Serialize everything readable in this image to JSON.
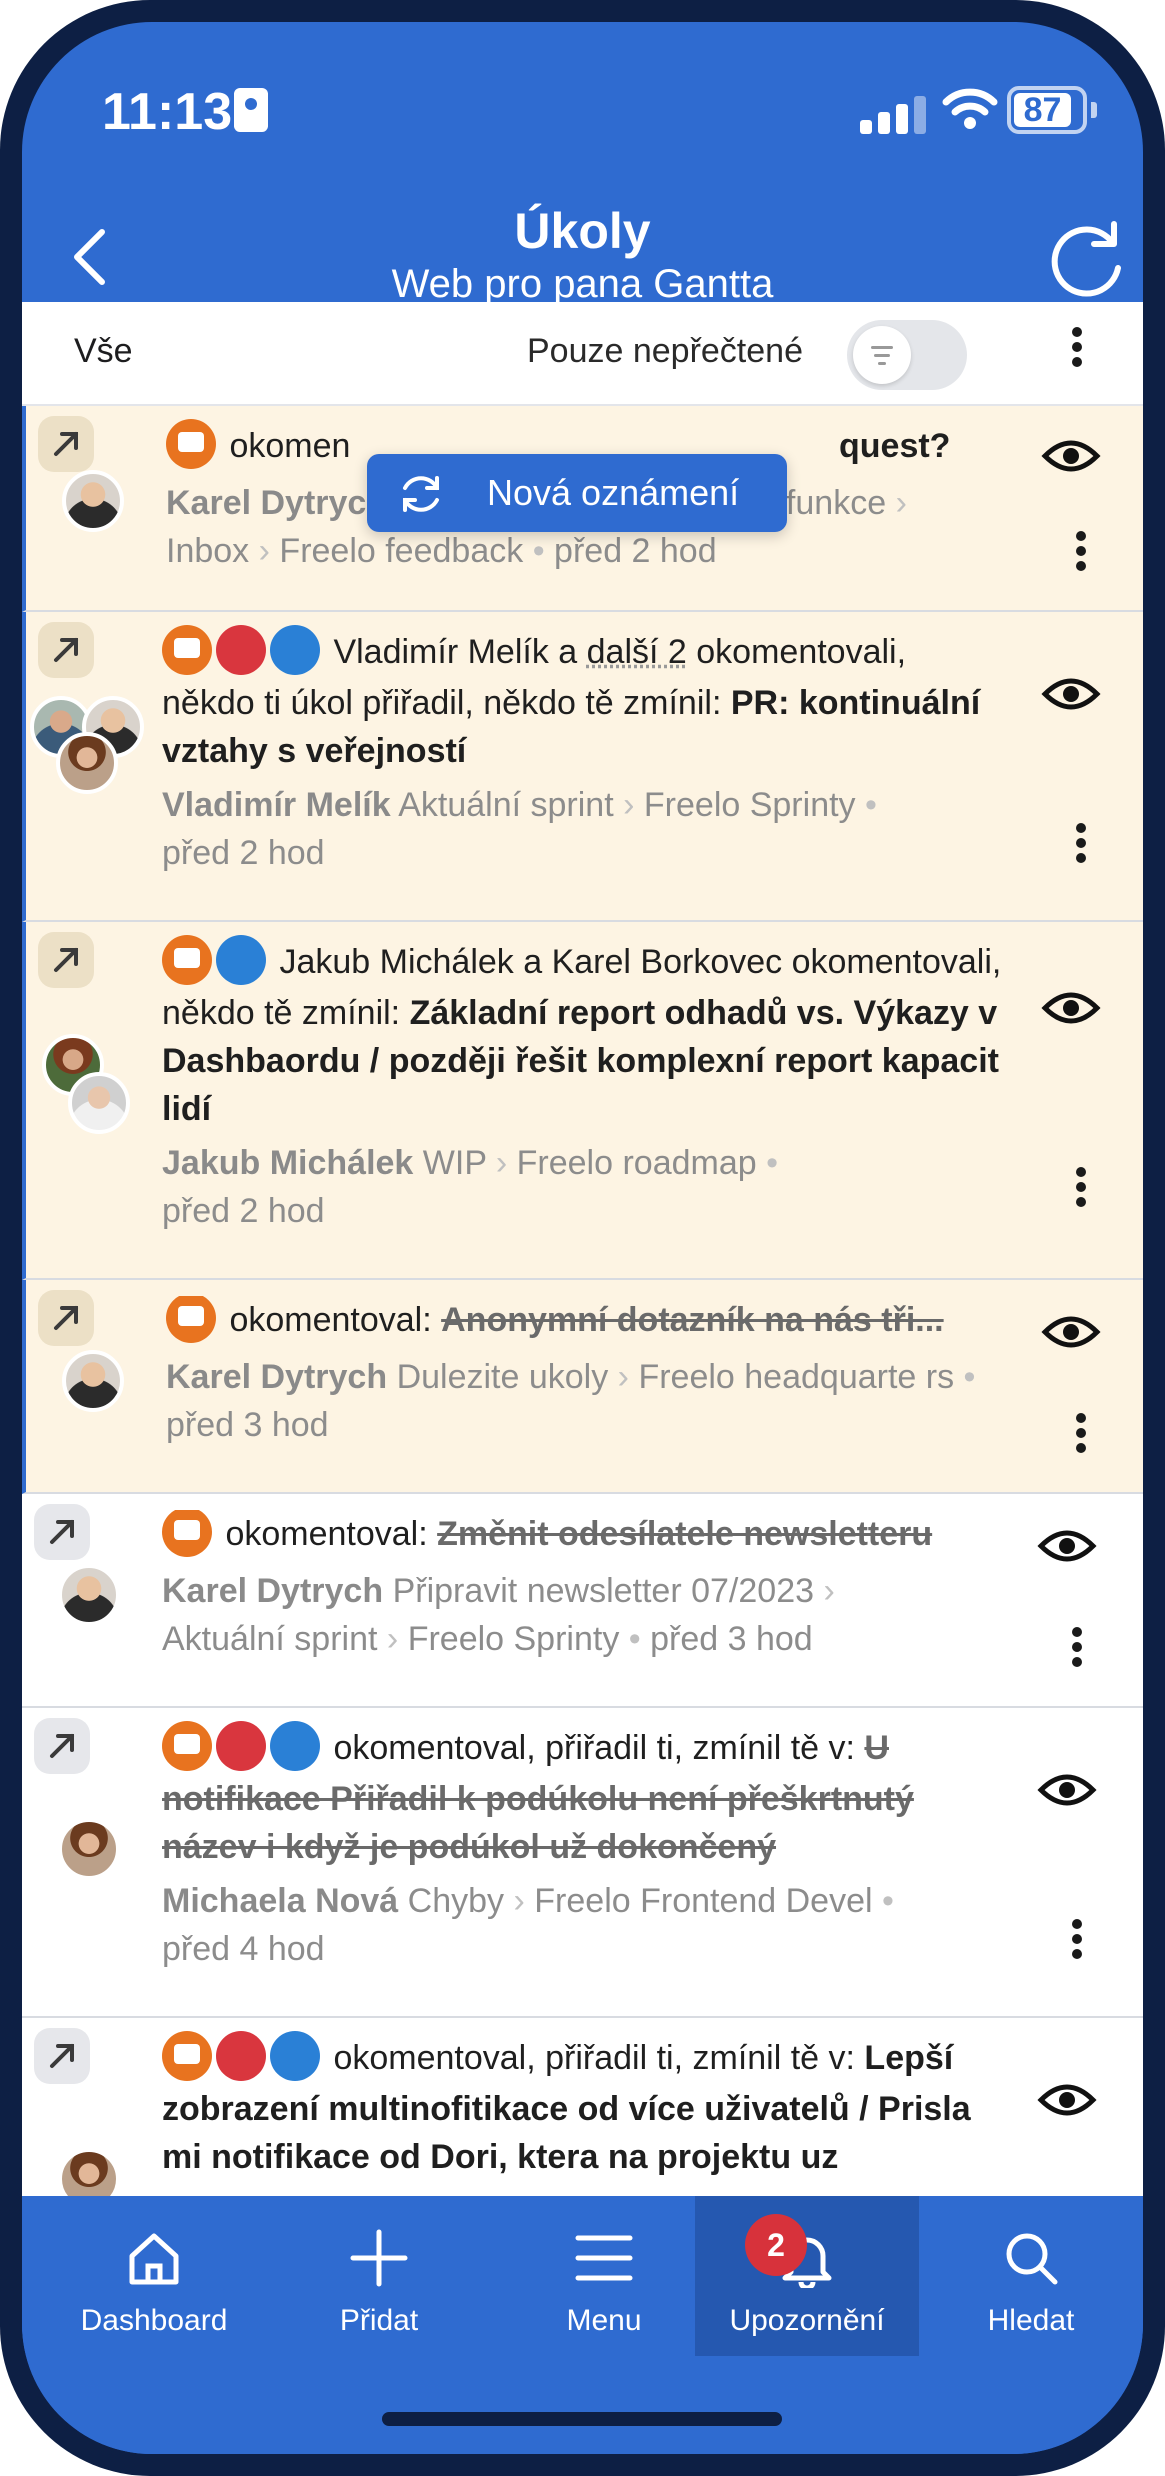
{
  "status": {
    "time": "11:13",
    "battery": "87"
  },
  "header": {
    "title": "Úkoly",
    "subtitle": "Web pro pana Gantta"
  },
  "filter": {
    "all_label": "Vše",
    "unread_label": "Pouze nepřečtené",
    "unread_enabled": false
  },
  "toast": {
    "label": "Nová oznámení"
  },
  "notifications": [
    {
      "read": false,
      "text_visible": "okomen",
      "text_tail": "quest?",
      "person": "Karel Dytrych",
      "path1": "Sběr Feedbacku na nové funkce",
      "path2": "Inbox",
      "path3": "Freelo feedback",
      "time": "před 2 hod"
    },
    {
      "read": false,
      "text_plain": "Vladimír Melík a ",
      "text_link": "další 2",
      "text_after": " okomentovali, někdo ti úkol přiřadil, někdo tě zmínil: ",
      "text_bold": "PR: kontinuální vztahy s veřejností",
      "person": "Vladimír Melík",
      "path1": "Aktuální sprint",
      "path2": "Freelo Sprinty",
      "time": "před 2 hod"
    },
    {
      "read": false,
      "text_plain": "Jakub Michálek a Karel Borkovec okomentovali, někdo tě zmínil: ",
      "text_bold": "Základní report odhadů vs. Výkazy v Dashbaordu / později řešit komplexní report kapacit lidí",
      "person": "Jakub Michálek",
      "path1": "WIP",
      "path2": "Freelo roadmap",
      "time": "před 2 hod"
    },
    {
      "read": false,
      "text_plain": "okomentoval: ",
      "text_strike": "Anonymní dotazník na nás tři...",
      "person": "Karel Dytrych",
      "path1": "Dulezite ukoly",
      "path2": "Freelo headquarte rs",
      "time": "před 3 hod"
    },
    {
      "read": true,
      "text_plain": "okomentoval: ",
      "text_strike": "Změnit odesílatele newsletteru",
      "person": "Karel Dytrych",
      "path1": "Připravit newsletter 07/2023",
      "path2": "Aktuální sprint",
      "path3": "Freelo Sprinty",
      "time": "před 3 hod"
    },
    {
      "read": true,
      "text_plain": "okomentoval, přiřadil ti, zmínil tě v: ",
      "text_strike": "U notifikace Přiřadil k podúkolu není přeškrtnutý název i když je podúkol už dokončený",
      "person": "Michaela Nová",
      "path1": "Chyby",
      "path2": "Freelo Frontend Devel",
      "time": "před 4 hod"
    },
    {
      "read": true,
      "text_plain": "okomentoval, přiřadil ti, zmínil tě v: ",
      "text_bold": "Lepší zobrazení multinofitikace od více uživatelů / Prisla mi notifikace od Dori, ktera na projektu uz"
    }
  ],
  "nav": {
    "items": [
      {
        "label": "Dashboard",
        "icon": "home-icon"
      },
      {
        "label": "Přidat",
        "icon": "plus-icon"
      },
      {
        "label": "Menu",
        "icon": "menu-icon"
      },
      {
        "label": "Upozornění",
        "icon": "bell-icon",
        "badge": "2",
        "active": true
      },
      {
        "label": "Hledat",
        "icon": "search-icon"
      }
    ]
  },
  "colors": {
    "primary": "#2f6bd0",
    "unread_bg": "#fdf4e3",
    "comment": "#e8731f",
    "assign": "#d9363e",
    "mention": "#2a80d6"
  }
}
